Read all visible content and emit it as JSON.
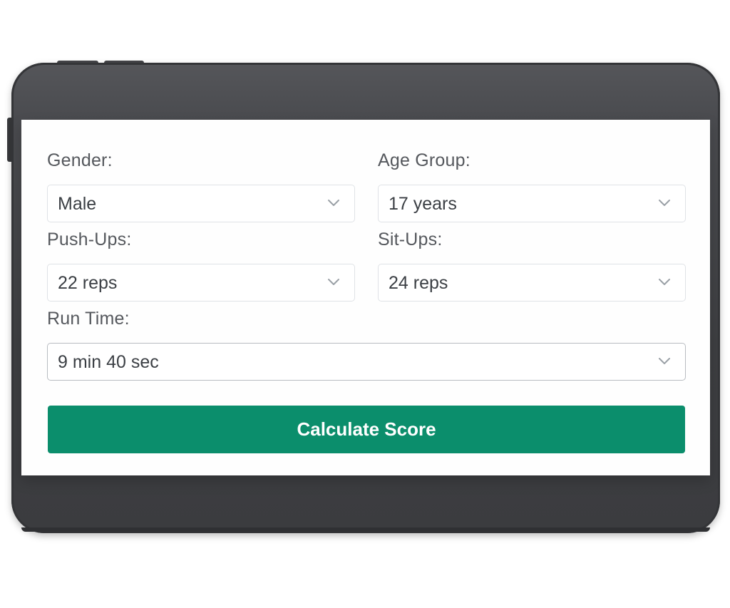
{
  "form": {
    "gender": {
      "label": "Gender:",
      "value": "Male"
    },
    "age_group": {
      "label": "Age Group:",
      "value": "17 years"
    },
    "push_ups": {
      "label": "Push-Ups:",
      "value": "22 reps"
    },
    "sit_ups": {
      "label": "Sit-Ups:",
      "value": "24 reps"
    },
    "run_time": {
      "label": "Run Time:",
      "value": "9 min 40 sec"
    }
  },
  "actions": {
    "calculate_label": "Calculate Score"
  },
  "colors": {
    "button_bg": "#0b8e6c",
    "device_frame": "#444548",
    "label_text": "#55585d"
  },
  "icons": {
    "dropdown": "chevron-down-icon"
  }
}
